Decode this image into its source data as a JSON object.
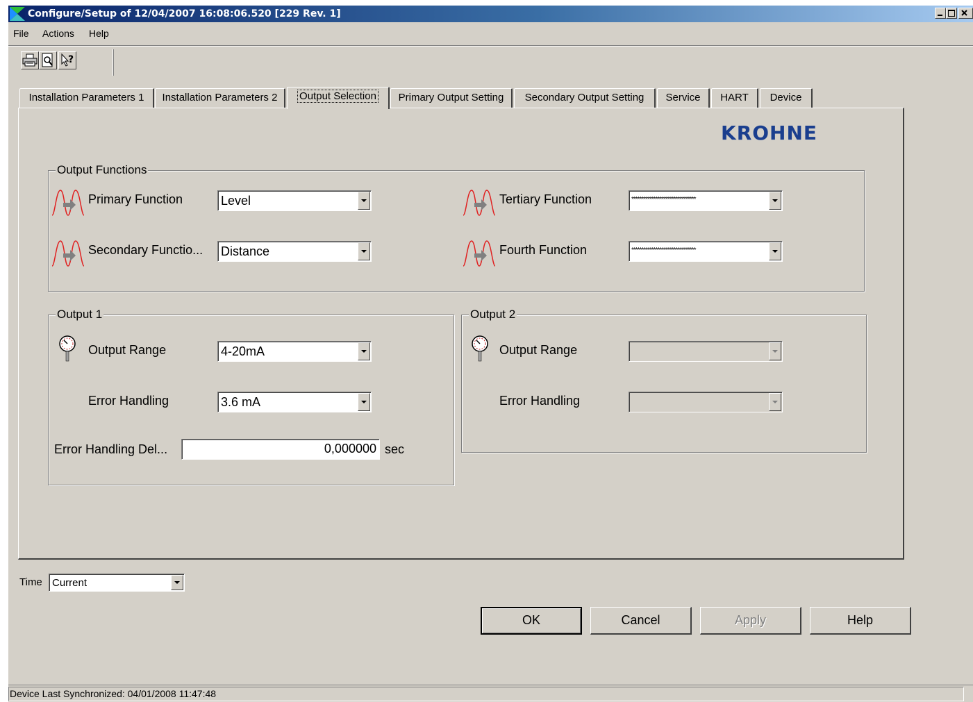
{
  "window": {
    "title": "Configure/Setup of 12/04/2007 16:08:06.520 [229 Rev. 1]"
  },
  "menu": {
    "items": [
      "File",
      "Actions",
      "Help"
    ]
  },
  "tabs": [
    {
      "label": "Installation Parameters 1"
    },
    {
      "label": "Installation Parameters 2"
    },
    {
      "label": "Output Selection",
      "active": true
    },
    {
      "label": "Primary Output Setting"
    },
    {
      "label": "Secondary Output Setting"
    },
    {
      "label": "Service"
    },
    {
      "label": "HART"
    },
    {
      "label": "Device"
    }
  ],
  "logo": "KROHNE",
  "output_functions": {
    "legend": "Output Functions",
    "primary": {
      "label": "Primary Function",
      "value": "Level"
    },
    "secondary": {
      "label": "Secondary Functio...",
      "value": "Distance"
    },
    "tertiary": {
      "label": "Tertiary Function",
      "value": "********************************"
    },
    "fourth": {
      "label": "Fourth Function",
      "value": "********************************"
    }
  },
  "output1": {
    "legend": "Output 1",
    "range": {
      "label": "Output Range",
      "value": "4-20mA"
    },
    "error_handling": {
      "label": "Error Handling",
      "value": "3.6 mA"
    },
    "delay": {
      "label": "Error Handling Del...",
      "value": "0,000000",
      "unit": "sec"
    }
  },
  "output2": {
    "legend": "Output 2",
    "range": {
      "label": "Output Range",
      "value": ""
    },
    "error_handling": {
      "label": "Error Handling",
      "value": ""
    }
  },
  "time": {
    "label": "Time",
    "value": "Current"
  },
  "buttons": {
    "ok": "OK",
    "cancel": "Cancel",
    "apply": "Apply",
    "help": "Help"
  },
  "status": "Device Last Synchronized: 04/01/2008 11:47:48",
  "colors": {
    "title_active": "#0a246a",
    "logo": "#1a3e8e",
    "function_icon": "#e02020",
    "face": "#d4d0c8"
  }
}
